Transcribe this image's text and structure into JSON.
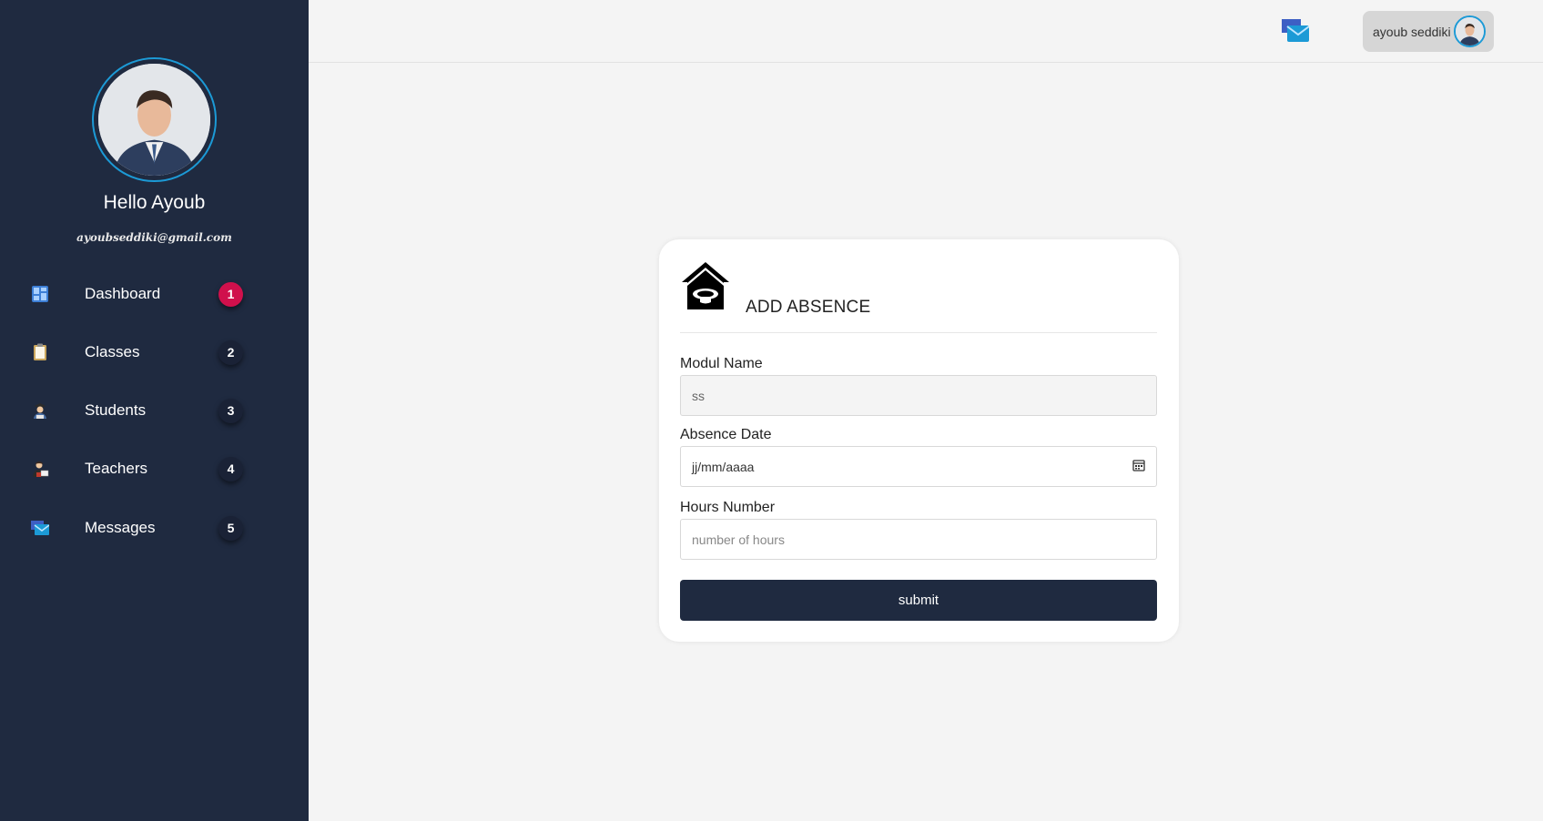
{
  "sidebar": {
    "greeting": "Hello Ayoub",
    "email": "ayoubseddiki@gmail.com",
    "items": [
      {
        "label": "Dashboard",
        "badge": "1",
        "icon": "dashboard-icon"
      },
      {
        "label": "Classes",
        "badge": "2",
        "icon": "clipboard-icon"
      },
      {
        "label": "Students",
        "badge": "3",
        "icon": "student-icon"
      },
      {
        "label": "Teachers",
        "badge": "4",
        "icon": "teacher-icon"
      },
      {
        "label": "Messages",
        "badge": "5",
        "icon": "mail-icon"
      }
    ]
  },
  "topbar": {
    "username": "ayoub seddiki",
    "mail_icon": "mail-icon"
  },
  "form": {
    "title": "ADD ABSENCE",
    "icon": "school-icon",
    "fields": {
      "module": {
        "label": "Modul Name",
        "value": "ss"
      },
      "date": {
        "label": "Absence Date",
        "placeholder": "jj/mm/aaaa"
      },
      "hours": {
        "label": "Hours Number",
        "placeholder": "number of hours"
      }
    },
    "submit_label": "submit"
  },
  "colors": {
    "sidebar_bg": "#1f2a40",
    "accent": "#1c9ad6",
    "active_badge": "#d0104c",
    "page_bg": "#f4f4f4"
  }
}
